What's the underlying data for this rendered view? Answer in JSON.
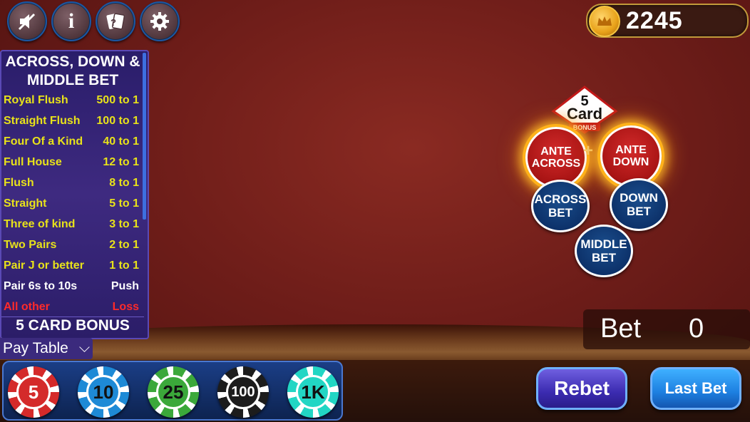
{
  "toolbar": {
    "mute_icon": "speaker-muted-icon",
    "info_icon": "info-icon",
    "cards_icon": "help-cards-icon",
    "settings_icon": "gear-icon",
    "info_glyph": "i"
  },
  "coins": {
    "balance": "2245",
    "icon": "crown-coin-icon"
  },
  "paytable": {
    "title": "ACROSS, DOWN & MIDDLE BET",
    "rows": [
      {
        "hand": "Royal Flush",
        "pay": "500 to 1",
        "color": "#e8e21a"
      },
      {
        "hand": "Straight Flush",
        "pay": "100 to 1",
        "color": "#e8e21a"
      },
      {
        "hand": "Four Of a Kind",
        "pay": "40 to 1",
        "color": "#e8e21a"
      },
      {
        "hand": "Full House",
        "pay": "12 to 1",
        "color": "#e8e21a"
      },
      {
        "hand": "Flush",
        "pay": "8 to 1",
        "color": "#e8e21a"
      },
      {
        "hand": "Straight",
        "pay": "5 to 1",
        "color": "#e8e21a"
      },
      {
        "hand": "Three of kind",
        "pay": "3 to 1",
        "color": "#e8e21a"
      },
      {
        "hand": "Two Pairs",
        "pay": "2 to 1",
        "color": "#e8e21a"
      },
      {
        "hand": "Pair J or better",
        "pay": "1 to 1",
        "color": "#e8e21a"
      },
      {
        "hand": "Pair 6s to 10s",
        "pay": "Push",
        "color": "#ffffff"
      },
      {
        "hand": "All other",
        "pay": "Loss",
        "color": "#ff2a2a"
      }
    ],
    "footer": "5 CARD BONUS",
    "toggle_label": "Pay Table"
  },
  "table": {
    "logo": {
      "top": "5",
      "main": "Card",
      "sub": "BONUS"
    },
    "ante_across": [
      "ANTE",
      "ACROSS"
    ],
    "ante_down": [
      "ANTE",
      "DOWN"
    ],
    "plus": "+",
    "across_bet": [
      "ACROSS",
      "BET"
    ],
    "down_bet": [
      "DOWN",
      "BET"
    ],
    "middle_bet": [
      "MIDDLE",
      "BET"
    ]
  },
  "bet": {
    "label": "Bet",
    "value": "0"
  },
  "chips": [
    {
      "label": "5",
      "color": "#d42a2a"
    },
    {
      "label": "10",
      "color": "#1e8ad6"
    },
    {
      "label": "25",
      "color": "#3ba83a"
    },
    {
      "label": "100",
      "color": "#1c1c1c"
    },
    {
      "label": "1K",
      "color": "#22d6c4"
    }
  ],
  "actions": {
    "rebet": "Rebet",
    "last_bet": "Last Bet"
  }
}
